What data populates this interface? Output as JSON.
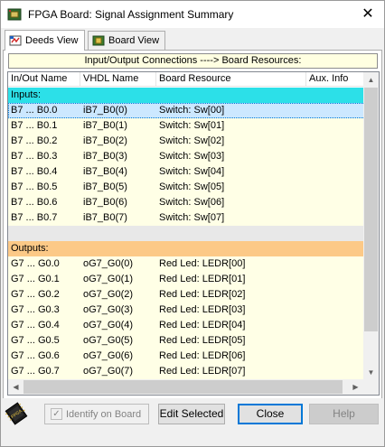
{
  "window": {
    "title": "FPGA Board: Signal Assignment Summary",
    "close_glyph": "✕",
    "app_icon": "fpga-board-icon"
  },
  "tabs": [
    {
      "label": "Deeds View",
      "icon": "deeds-logo-icon",
      "active": true
    },
    {
      "label": "Board View",
      "icon": "board-chip-icon",
      "active": false
    }
  ],
  "panel": {
    "header": "Input/Output Connections ----> Board Resources:"
  },
  "table": {
    "columns": [
      "In/Out Name",
      "VHDL Name",
      "Board Resource",
      "Aux. Info"
    ],
    "inputs_label": "Inputs:",
    "outputs_label": "Outputs:",
    "inputs": [
      {
        "io": "B7 ... B0.0",
        "vhdl": "iB7_B0(0)",
        "resource": "Switch: Sw[00]",
        "aux": "",
        "selected": true
      },
      {
        "io": "B7 ... B0.1",
        "vhdl": "iB7_B0(1)",
        "resource": "Switch: Sw[01]",
        "aux": ""
      },
      {
        "io": "B7 ... B0.2",
        "vhdl": "iB7_B0(2)",
        "resource": "Switch: Sw[02]",
        "aux": ""
      },
      {
        "io": "B7 ... B0.3",
        "vhdl": "iB7_B0(3)",
        "resource": "Switch: Sw[03]",
        "aux": ""
      },
      {
        "io": "B7 ... B0.4",
        "vhdl": "iB7_B0(4)",
        "resource": "Switch: Sw[04]",
        "aux": ""
      },
      {
        "io": "B7 ... B0.5",
        "vhdl": "iB7_B0(5)",
        "resource": "Switch: Sw[05]",
        "aux": ""
      },
      {
        "io": "B7 ... B0.6",
        "vhdl": "iB7_B0(6)",
        "resource": "Switch: Sw[06]",
        "aux": ""
      },
      {
        "io": "B7 ... B0.7",
        "vhdl": "iB7_B0(7)",
        "resource": "Switch: Sw[07]",
        "aux": ""
      }
    ],
    "outputs": [
      {
        "io": "G7 ... G0.0",
        "vhdl": "oG7_G0(0)",
        "resource": "Red Led: LEDR[00]",
        "aux": ""
      },
      {
        "io": "G7 ... G0.1",
        "vhdl": "oG7_G0(1)",
        "resource": "Red Led: LEDR[01]",
        "aux": ""
      },
      {
        "io": "G7 ... G0.2",
        "vhdl": "oG7_G0(2)",
        "resource": "Red Led: LEDR[02]",
        "aux": ""
      },
      {
        "io": "G7 ... G0.3",
        "vhdl": "oG7_G0(3)",
        "resource": "Red Led: LEDR[03]",
        "aux": ""
      },
      {
        "io": "G7 ... G0.4",
        "vhdl": "oG7_G0(4)",
        "resource": "Red Led: LEDR[04]",
        "aux": ""
      },
      {
        "io": "G7 ... G0.5",
        "vhdl": "oG7_G0(5)",
        "resource": "Red Led: LEDR[05]",
        "aux": ""
      },
      {
        "io": "G7 ... G0.6",
        "vhdl": "oG7_G0(6)",
        "resource": "Red Led: LEDR[06]",
        "aux": ""
      },
      {
        "io": "G7 ... G0.7",
        "vhdl": "oG7_G0(7)",
        "resource": "Red Led: LEDR[07]",
        "aux": ""
      }
    ]
  },
  "bottom": {
    "chip_icon": "fpga-chip-icon",
    "identify_label": "Identify on Board",
    "identify_checked": true,
    "identify_enabled": false,
    "edit_label": "Edit Selected",
    "close_label": "Close",
    "help_label": "Help"
  },
  "colors": {
    "inputs_section": "#2ce0e8",
    "outputs_section": "#fcc987",
    "data_row": "#ffffe6",
    "selected_row": "#cce8ff",
    "header_box": "#ffffe1",
    "default_button_border": "#0078d7"
  }
}
